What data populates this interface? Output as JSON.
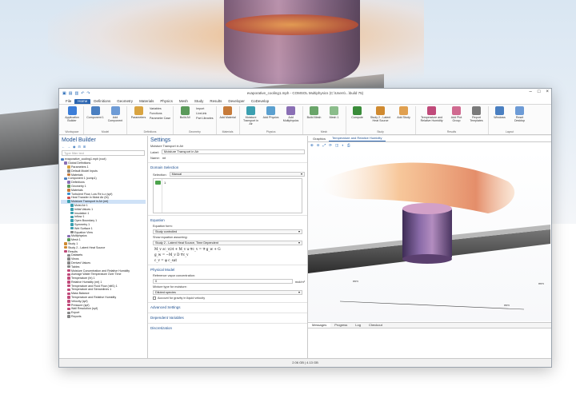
{
  "window": {
    "title": "evaporative_cooling1.mph - COMSOL Multiphysics (C:\\Users\\...\\build 75)"
  },
  "menu": {
    "tabs": [
      {
        "label": "File"
      },
      {
        "label": "Home"
      },
      {
        "label": "Definitions"
      },
      {
        "label": "Geometry"
      },
      {
        "label": "Materials"
      },
      {
        "label": "Physics"
      },
      {
        "label": "Mesh"
      },
      {
        "label": "Study"
      },
      {
        "label": "Results"
      },
      {
        "label": "Developer"
      },
      {
        "label": "CoDevelop"
      }
    ]
  },
  "ribbon": {
    "workspace": {
      "app_builder": "Application Builder",
      "group": "Workspace"
    },
    "model": {
      "component": "Component 1",
      "add_component": "Add Component",
      "group": "Model"
    },
    "definitions": {
      "parameters": "Parameters",
      "variables": "Variables",
      "functions": "Functions",
      "parameter_case": "Parameter Case",
      "group": "Definitions"
    },
    "geometry": {
      "build_all": "Build All",
      "import": "Import",
      "livelink": "LiveLink",
      "part_libraries": "Part Libraries",
      "group": "Geometry"
    },
    "materials": {
      "add_material": "Add Material",
      "group": "Materials"
    },
    "physics": {
      "moisture": "Moisture Transport in Air",
      "add_physics": "Add Physics",
      "add_multiphysics": "Add Multiphysics",
      "group": "Physics"
    },
    "mesh": {
      "build_mesh": "Build Mesh",
      "mesh1": "Mesh 1",
      "group": "Mesh"
    },
    "study": {
      "compute": "Compute",
      "study2": "Study 2 - Latent Heat Source",
      "add_study": "Add Study",
      "group": "Study"
    },
    "results": {
      "temp_humidity": "Temperature and Relative Humidity",
      "add_plot_group": "Add Plot Group",
      "report": "Report Templates",
      "group": "Results"
    },
    "layout": {
      "windows": "Windows",
      "reset_desktop": "Reset Desktop",
      "group": "Layout"
    }
  },
  "model_builder": {
    "title": "Model Builder",
    "search_placeholder": "Type filter text",
    "tree": [
      {
        "label": "evaporative_cooling1.mph (root)",
        "color": "#4a7fc1"
      },
      {
        "label": "Global Definitions",
        "color": "#8a6fb5"
      },
      {
        "label": "Parameters 1",
        "color": "#d9a441"
      },
      {
        "label": "Default Model Inputs",
        "color": "#888888"
      },
      {
        "label": "Materials",
        "color": "#c77b3a"
      },
      {
        "label": "Component 1 (comp1)",
        "color": "#4a7fc1"
      },
      {
        "label": "Definitions",
        "color": "#8a6fb5"
      },
      {
        "label": "Geometry 1",
        "color": "#5a9a5a"
      },
      {
        "label": "Materials",
        "color": "#c77b3a"
      },
      {
        "label": "Turbulent Flow, Low Re k-ε (spf)",
        "color": "#3b8fd1"
      },
      {
        "label": "Heat Transfer in Moist Air (ht)",
        "color": "#d05050"
      },
      {
        "label": "Moisture Transport in Air (mt)",
        "color": "#3b9fb0",
        "selected": true
      },
      {
        "label": "Moist Air 1",
        "color": "#3b9fb0"
      },
      {
        "label": "Initial Values 1",
        "color": "#3b9fb0"
      },
      {
        "label": "Insulation 1",
        "color": "#3b9fb0"
      },
      {
        "label": "Inflow 1",
        "color": "#3b9fb0"
      },
      {
        "label": "Open Boundary 1",
        "color": "#3b9fb0"
      },
      {
        "label": "Symmetry 1",
        "color": "#3b9fb0"
      },
      {
        "label": "Wet Surface 1",
        "color": "#3b9fb0"
      },
      {
        "label": "Equation View",
        "color": "#888888"
      },
      {
        "label": "Multiphysics",
        "color": "#8a6fb5"
      },
      {
        "label": "Mesh 1",
        "color": "#5a9a5a"
      },
      {
        "label": "Study 1",
        "color": "#d08a30"
      },
      {
        "label": "Study 2 - Latent Heat Source",
        "color": "#d08a30"
      },
      {
        "label": "Results",
        "color": "#c04a7a"
      },
      {
        "label": "Datasets",
        "color": "#888888"
      },
      {
        "label": "Views",
        "color": "#888888"
      },
      {
        "label": "Derived Values",
        "color": "#888888"
      },
      {
        "label": "Tables",
        "color": "#888888"
      },
      {
        "label": "Moisture Concentration and Relative Humidity",
        "color": "#c04a7a"
      },
      {
        "label": "Average Water Temperature Over Time",
        "color": "#c04a7a"
      },
      {
        "label": "Temperature (ht) 1",
        "color": "#c04a7a"
      },
      {
        "label": "Relative Humidity (mt) 1",
        "color": "#c04a7a"
      },
      {
        "label": "Temperature and Fluid Flow (nitf1) 1",
        "color": "#c04a7a"
      },
      {
        "label": "Temperature and Streamlines 1",
        "color": "#c04a7a"
      },
      {
        "label": "Mass Balance",
        "color": "#c04a7a"
      },
      {
        "label": "Temperature and Relative Humidity",
        "color": "#c04a7a"
      },
      {
        "label": "Velocity (spf)",
        "color": "#c04a7a"
      },
      {
        "label": "Pressure (spf)",
        "color": "#c04a7a"
      },
      {
        "label": "Wall Resolution (spf)",
        "color": "#c04a7a"
      },
      {
        "label": "Export",
        "color": "#888888"
      },
      {
        "label": "Reports",
        "color": "#888888"
      }
    ]
  },
  "settings": {
    "title": "Settings",
    "subtitle": "Moisture Transport in Air",
    "label_caption": "Label:",
    "label_value": "Moisture Transport in Air",
    "name_caption": "Name:",
    "name_value": "mt",
    "domain_selection": {
      "header": "Domain Selection",
      "selection_caption": "Selection:",
      "selection_value": "Manual",
      "items": "1"
    },
    "equation": {
      "header": "Equation",
      "form_caption": "Equation form:",
      "form_value": "Study controlled",
      "show_caption": "Show equation assuming:",
      "show_value": "Study 2 - Latent Heat Source, Time Dependent",
      "eq1": "M_v ∂c_v/∂t + M_v u·∇c_v = ∇·g_w + G",
      "eq2": "g_w = −M_v D ∇c_v",
      "eq3": "c_v = φ c_sat"
    },
    "physical_model": {
      "header": "Physical Model",
      "ref_caption": "Reference vapor concentration:",
      "ref_value": "0",
      "ref_unit": "mol/m³",
      "mixture_caption": "Mixture type for moisture:",
      "mixture_value": "Diluted species",
      "gravity_caption": "Account for gravity in liquid velocity"
    },
    "advanced": "Advanced Settings",
    "dependent": "Dependent Variables",
    "discretization": "Discretization"
  },
  "graphics": {
    "tabs": [
      {
        "label": "Graphics"
      },
      {
        "label": "Temperature and Relative Humidity"
      }
    ],
    "axis_labels": [
      "mm",
      "mm",
      "mm"
    ],
    "bottom_tabs": [
      {
        "label": "Messages"
      },
      {
        "label": "Progress"
      },
      {
        "label": "Log"
      },
      {
        "label": "Checkout"
      }
    ]
  },
  "status": {
    "memory": "2.06 GB | 4.13 GB"
  },
  "colors": {
    "accent": "#2a64b0",
    "title_blue": "#1e4f8f"
  }
}
